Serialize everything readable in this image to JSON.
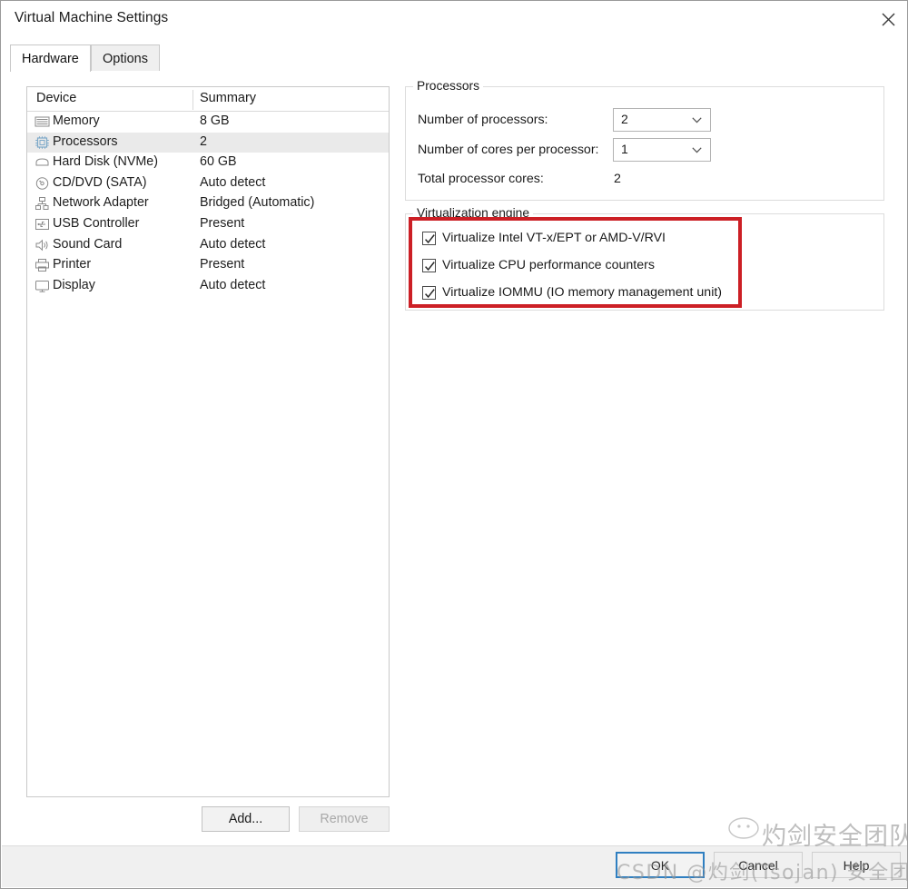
{
  "window": {
    "title": "Virtual Machine Settings",
    "close_icon": "close-icon"
  },
  "tabs": [
    {
      "label": "Hardware",
      "active": true
    },
    {
      "label": "Options",
      "active": false
    }
  ],
  "device_list": {
    "columns": {
      "device": "Device",
      "summary": "Summary"
    },
    "rows": [
      {
        "icon": "memory-icon",
        "name": "Memory",
        "summary": "8 GB",
        "selected": false
      },
      {
        "icon": "processor-icon",
        "name": "Processors",
        "summary": "2",
        "selected": true
      },
      {
        "icon": "hard-disk-icon",
        "name": "Hard Disk (NVMe)",
        "summary": "60 GB",
        "selected": false
      },
      {
        "icon": "cd-dvd-icon",
        "name": "CD/DVD (SATA)",
        "summary": "Auto detect",
        "selected": false
      },
      {
        "icon": "network-adapter-icon",
        "name": "Network Adapter",
        "summary": "Bridged (Automatic)",
        "selected": false
      },
      {
        "icon": "usb-controller-icon",
        "name": "USB Controller",
        "summary": "Present",
        "selected": false
      },
      {
        "icon": "sound-card-icon",
        "name": "Sound Card",
        "summary": "Auto detect",
        "selected": false
      },
      {
        "icon": "printer-icon",
        "name": "Printer",
        "summary": "Present",
        "selected": false
      },
      {
        "icon": "display-icon",
        "name": "Display",
        "summary": "Auto detect",
        "selected": false
      }
    ]
  },
  "device_actions": {
    "add_label": "Add...",
    "remove_label": "Remove",
    "remove_disabled": true
  },
  "processors_group": {
    "title": "Processors",
    "num_processors_label": "Number of processors:",
    "num_processors_value": "2",
    "cores_per_processor_label": "Number of cores per processor:",
    "cores_per_processor_value": "1",
    "total_cores_label": "Total processor cores:",
    "total_cores_value": "2"
  },
  "virtualization_group": {
    "title": "Virtualization engine",
    "checkboxes": [
      {
        "label": "Virtualize Intel VT-x/EPT or AMD-V/RVI",
        "checked": true
      },
      {
        "label": "Virtualize CPU performance counters",
        "checked": true
      },
      {
        "label": "Virtualize IOMMU (IO memory management unit)",
        "checked": true
      }
    ],
    "highlight_color": "#cc1f25"
  },
  "dialog_buttons": {
    "ok_label": "OK",
    "cancel_label": "Cancel",
    "help_label": "Help",
    "focus_color": "#2f7fc1"
  },
  "watermark": {
    "cjk_text": "灼剑安全团队",
    "csdn_text": "CSDN @灼剑(Tsojan) 安全团队"
  }
}
